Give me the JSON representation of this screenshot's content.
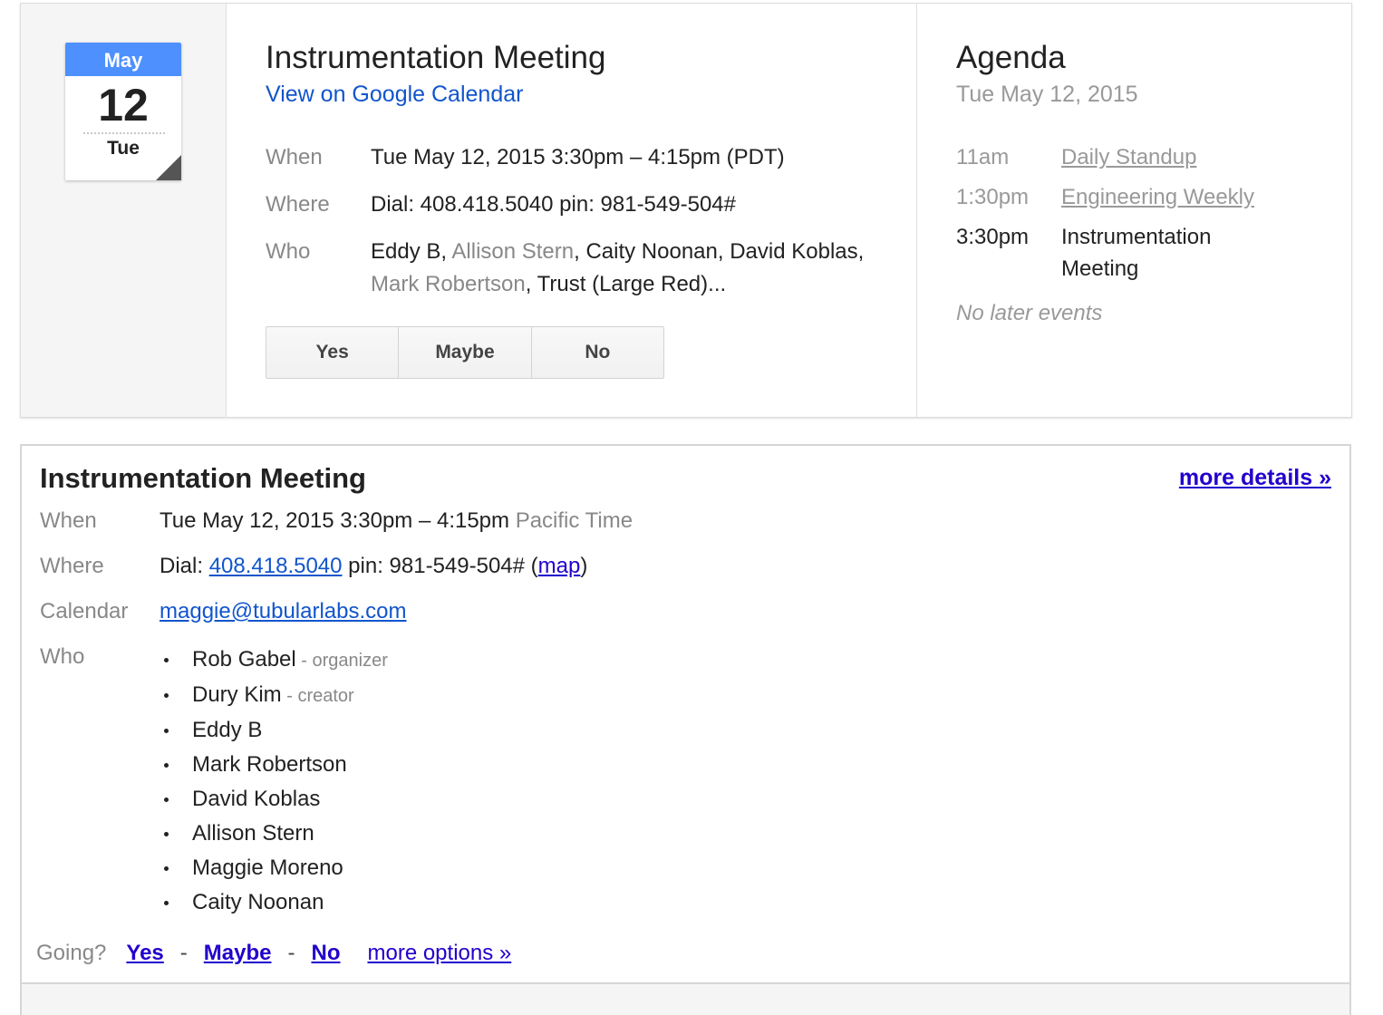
{
  "date_tile": {
    "month": "May",
    "day": "12",
    "weekday": "Tue"
  },
  "event": {
    "title": "Instrumentation Meeting",
    "view_link": "View on Google Calendar",
    "when_label": "When",
    "when_value": "Tue May 12, 2015 3:30pm – 4:15pm (PDT)",
    "where_label": "Where",
    "where_value": "Dial: 408.418.5040 pin: 981-549-504#",
    "who_label": "Who",
    "who_parts": [
      "Eddy B, ",
      "Allison Stern",
      ", Caity Noonan, David Koblas, ",
      "Mark Robertson",
      ", Trust (Large Red)..."
    ],
    "rsvp": {
      "yes": "Yes",
      "maybe": "Maybe",
      "no": "No"
    }
  },
  "agenda": {
    "title": "Agenda",
    "date": "Tue May 12, 2015",
    "items": [
      {
        "time": "11am",
        "name": "Daily Standup"
      },
      {
        "time": "1:30pm",
        "name": "Engineering Weekly"
      },
      {
        "time": "3:30pm",
        "name": "Instrumentation Meeting"
      }
    ],
    "no_later": "No later events"
  },
  "details": {
    "title": "Instrumentation Meeting",
    "more_details": "more details »",
    "when_label": "When",
    "when_value": "Tue May 12, 2015 3:30pm – 4:15pm",
    "when_tz": "Pacific Time",
    "where_label": "Where",
    "where_prefix": "Dial: ",
    "where_phone": "408.418.5040",
    "where_mid": " pin: 981-549-504# (",
    "where_map": "map",
    "where_suffix": ")",
    "calendar_label": "Calendar",
    "calendar_value": "maggie@tubularlabs.com",
    "who_label": "Who",
    "attendees": [
      {
        "name": "Rob Gabel",
        "role": " - organizer"
      },
      {
        "name": "Dury Kim",
        "role": " - creator"
      },
      {
        "name": "Eddy B",
        "role": ""
      },
      {
        "name": "Mark Robertson",
        "role": ""
      },
      {
        "name": "David Koblas",
        "role": ""
      },
      {
        "name": "Allison Stern",
        "role": ""
      },
      {
        "name": "Maggie Moreno",
        "role": ""
      },
      {
        "name": "Caity Noonan",
        "role": ""
      }
    ],
    "going": {
      "question": "Going?",
      "yes": "Yes",
      "sep": "-",
      "maybe": "Maybe",
      "no": "No",
      "more_options": "more options »"
    }
  },
  "colors": {
    "accent_blue": "#4d90fe",
    "link_blue": "#1155cc",
    "link_purple": "#2200cc"
  }
}
